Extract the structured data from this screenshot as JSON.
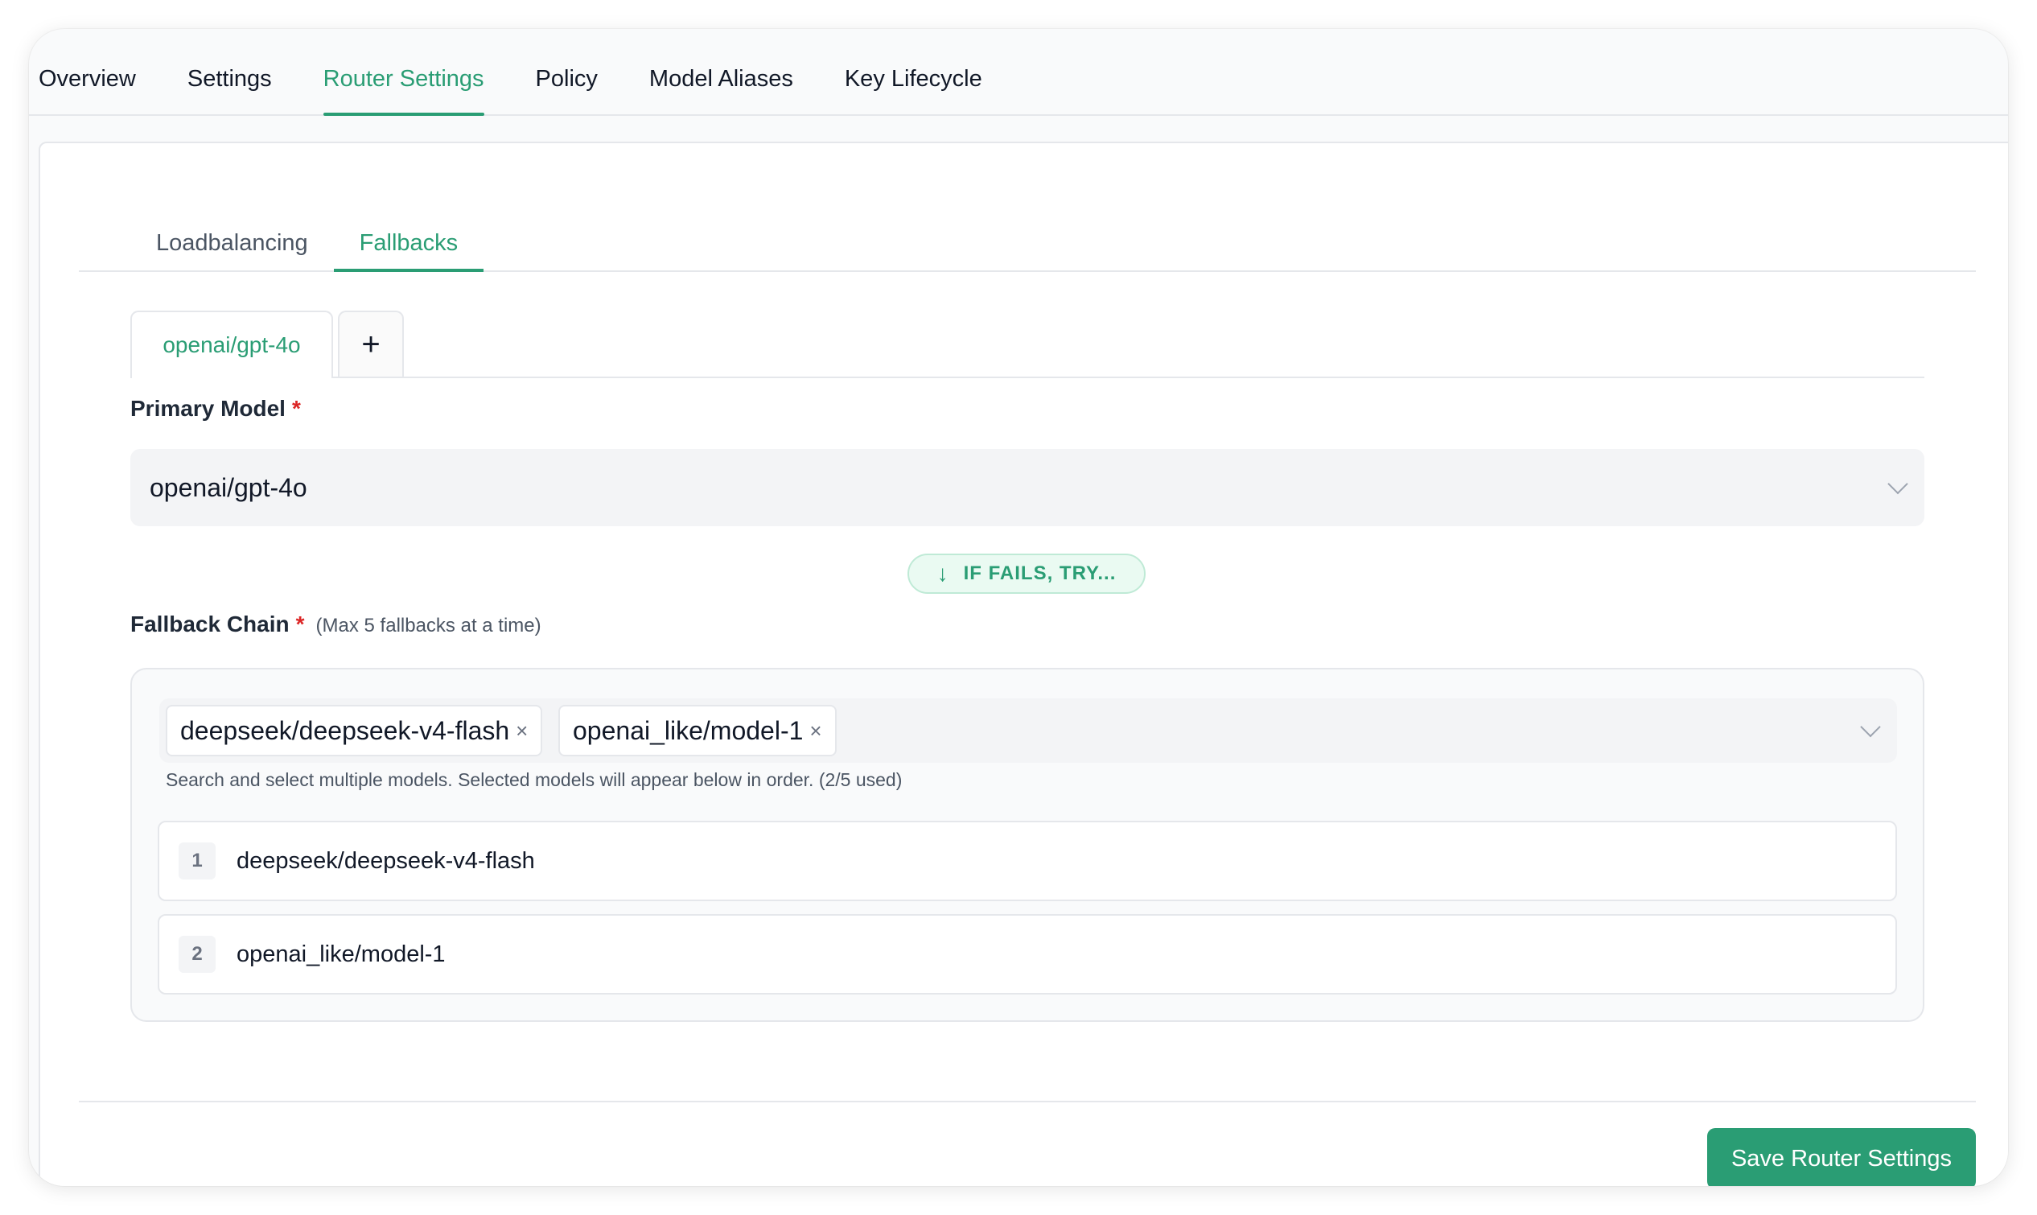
{
  "top_tabs": [
    {
      "label": "Overview",
      "active": false
    },
    {
      "label": "Settings",
      "active": false
    },
    {
      "label": "Router Settings",
      "active": true
    },
    {
      "label": "Policy",
      "active": false
    },
    {
      "label": "Model Aliases",
      "active": false
    },
    {
      "label": "Key Lifecycle",
      "active": false
    }
  ],
  "sub_tabs": [
    {
      "label": "Loadbalancing",
      "active": false
    },
    {
      "label": "Fallbacks",
      "active": true
    }
  ],
  "model_tabs": {
    "active_label": "openai/gpt-4o",
    "add_label": "+"
  },
  "primary_model": {
    "label": "Primary Model",
    "required_mark": "*",
    "value": "openai/gpt-4o"
  },
  "fails_badge": {
    "text": "IF FAILS, TRY..."
  },
  "fallback_chain": {
    "label": "Fallback Chain",
    "required_mark": "*",
    "hint": "(Max 5 fallbacks at a time)",
    "selected": [
      {
        "label": "deepseek/deepseek-v4-flash",
        "remove": "×"
      },
      {
        "label": "openai_like/model-1",
        "remove": "×"
      }
    ],
    "helper": "Search and select multiple models. Selected models will appear below in order. (2/5 used)",
    "ordered": [
      {
        "num": "1",
        "name": "deepseek/deepseek-v4-flash"
      },
      {
        "num": "2",
        "name": "openai_like/model-1"
      }
    ]
  },
  "save_button": "Save Router Settings",
  "colors": {
    "accent": "#2a9d74",
    "required": "#dc2626"
  }
}
